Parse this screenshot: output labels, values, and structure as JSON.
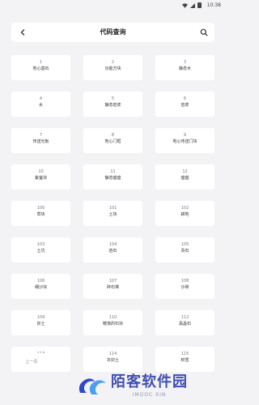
{
  "status_bar": {
    "time": "10:38"
  },
  "header": {
    "title": "代码查询"
  },
  "items": [
    {
      "code": "1",
      "name": "地心基石"
    },
    {
      "code": "2",
      "name": "功能方块"
    },
    {
      "code": "3",
      "name": "静态木"
    },
    {
      "code": "4",
      "name": "水"
    },
    {
      "code": "5",
      "name": "静态岩浆"
    },
    {
      "code": "6",
      "name": "岩浆"
    },
    {
      "code": "7",
      "name": "传送光板"
    },
    {
      "code": "8",
      "name": "地心门框"
    },
    {
      "code": "9",
      "name": "地心传送门块"
    },
    {
      "code": "10",
      "name": "紫萤块"
    },
    {
      "code": "11",
      "name": "静态瘟瘟"
    },
    {
      "code": "12",
      "name": "瘟瘟"
    },
    {
      "code": "100",
      "name": "草块"
    },
    {
      "code": "101",
      "name": "土块"
    },
    {
      "code": "102",
      "name": "耕地"
    },
    {
      "code": "103",
      "name": "土坑"
    },
    {
      "code": "104",
      "name": "岩石"
    },
    {
      "code": "105",
      "name": "青石"
    },
    {
      "code": "106",
      "name": "细沙块"
    },
    {
      "code": "107",
      "name": "碎石堆"
    },
    {
      "code": "108",
      "name": "沙砖"
    },
    {
      "code": "109",
      "name": "卯土"
    },
    {
      "code": "110",
      "name": "散落的石块"
    },
    {
      "code": "112",
      "name": "黑晶石"
    },
    {
      "code": "113",
      "name": "菌冰"
    },
    {
      "code": "114",
      "name": "灰卯土"
    },
    {
      "code": "115",
      "name": "积雪"
    }
  ],
  "footer": {
    "prev_label": "上一页"
  },
  "watermark": {
    "cn": "陌客软件园",
    "en": "IMOOC XIN"
  }
}
